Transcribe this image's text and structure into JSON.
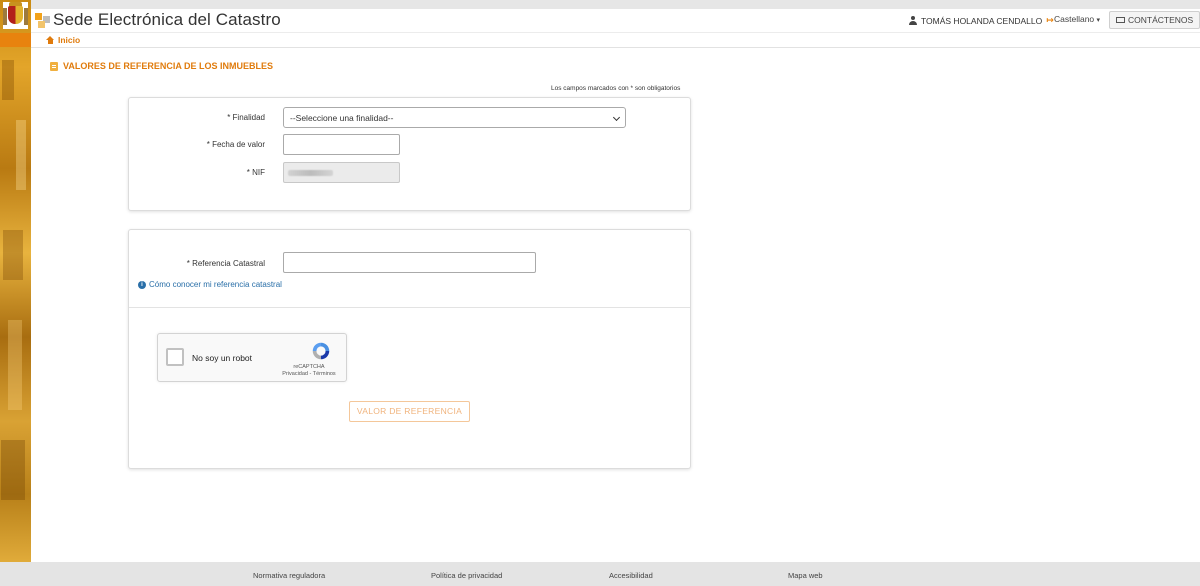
{
  "header": {
    "site_title": "Sede Electrónica del Catastro",
    "user_name": "TOMÁS HOLANDA CENDALLO",
    "language": "Castellano",
    "contact_label": "CONTÁCTENOS"
  },
  "breadcrumb": {
    "home_label": "Inicio"
  },
  "page": {
    "title": "VALORES DE REFERENCIA DE LOS INMUEBLES",
    "required_note": "Los campos marcados con * son obligatorios"
  },
  "form": {
    "finalidad_label": "* Finalidad",
    "finalidad_value": "--Seleccione una finalidad--",
    "fecha_label": "* Fecha de valor",
    "fecha_value": "",
    "nif_label": "* NIF",
    "referencia_label": "* Referencia Catastral",
    "referencia_value": "",
    "help_link": "Cómo conocer mi referencia catastral",
    "captcha_label": "No soy un robot",
    "captcha_brand": "reCAPTCHA",
    "captcha_links": "Privacidad - Términos",
    "submit_label": "VALOR DE REFERENCIA"
  },
  "footer": {
    "links": [
      "Normativa reguladora",
      "Política de privacidad",
      "Accesibilidad",
      "Mapa web"
    ]
  },
  "colors": {
    "accent": "#e07b0c",
    "link": "#2a6fa8",
    "footer_bg": "#e4e4e4"
  }
}
